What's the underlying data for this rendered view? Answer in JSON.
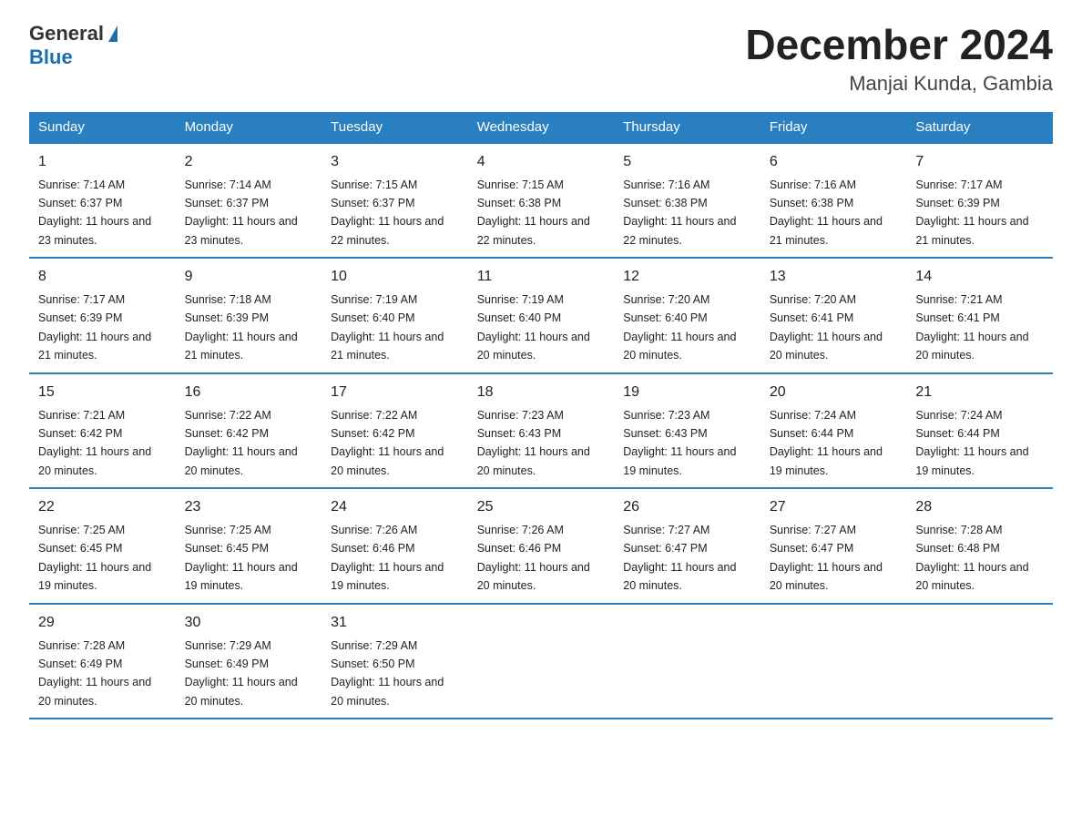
{
  "logo": {
    "general": "General",
    "blue": "Blue"
  },
  "title": "December 2024",
  "subtitle": "Manjai Kunda, Gambia",
  "days_of_week": [
    "Sunday",
    "Monday",
    "Tuesday",
    "Wednesday",
    "Thursday",
    "Friday",
    "Saturday"
  ],
  "weeks": [
    [
      {
        "day": "1",
        "sunrise": "7:14 AM",
        "sunset": "6:37 PM",
        "daylight": "11 hours and 23 minutes."
      },
      {
        "day": "2",
        "sunrise": "7:14 AM",
        "sunset": "6:37 PM",
        "daylight": "11 hours and 23 minutes."
      },
      {
        "day": "3",
        "sunrise": "7:15 AM",
        "sunset": "6:37 PM",
        "daylight": "11 hours and 22 minutes."
      },
      {
        "day": "4",
        "sunrise": "7:15 AM",
        "sunset": "6:38 PM",
        "daylight": "11 hours and 22 minutes."
      },
      {
        "day": "5",
        "sunrise": "7:16 AM",
        "sunset": "6:38 PM",
        "daylight": "11 hours and 22 minutes."
      },
      {
        "day": "6",
        "sunrise": "7:16 AM",
        "sunset": "6:38 PM",
        "daylight": "11 hours and 21 minutes."
      },
      {
        "day": "7",
        "sunrise": "7:17 AM",
        "sunset": "6:39 PM",
        "daylight": "11 hours and 21 minutes."
      }
    ],
    [
      {
        "day": "8",
        "sunrise": "7:17 AM",
        "sunset": "6:39 PM",
        "daylight": "11 hours and 21 minutes."
      },
      {
        "day": "9",
        "sunrise": "7:18 AM",
        "sunset": "6:39 PM",
        "daylight": "11 hours and 21 minutes."
      },
      {
        "day": "10",
        "sunrise": "7:19 AM",
        "sunset": "6:40 PM",
        "daylight": "11 hours and 21 minutes."
      },
      {
        "day": "11",
        "sunrise": "7:19 AM",
        "sunset": "6:40 PM",
        "daylight": "11 hours and 20 minutes."
      },
      {
        "day": "12",
        "sunrise": "7:20 AM",
        "sunset": "6:40 PM",
        "daylight": "11 hours and 20 minutes."
      },
      {
        "day": "13",
        "sunrise": "7:20 AM",
        "sunset": "6:41 PM",
        "daylight": "11 hours and 20 minutes."
      },
      {
        "day": "14",
        "sunrise": "7:21 AM",
        "sunset": "6:41 PM",
        "daylight": "11 hours and 20 minutes."
      }
    ],
    [
      {
        "day": "15",
        "sunrise": "7:21 AM",
        "sunset": "6:42 PM",
        "daylight": "11 hours and 20 minutes."
      },
      {
        "day": "16",
        "sunrise": "7:22 AM",
        "sunset": "6:42 PM",
        "daylight": "11 hours and 20 minutes."
      },
      {
        "day": "17",
        "sunrise": "7:22 AM",
        "sunset": "6:42 PM",
        "daylight": "11 hours and 20 minutes."
      },
      {
        "day": "18",
        "sunrise": "7:23 AM",
        "sunset": "6:43 PM",
        "daylight": "11 hours and 20 minutes."
      },
      {
        "day": "19",
        "sunrise": "7:23 AM",
        "sunset": "6:43 PM",
        "daylight": "11 hours and 19 minutes."
      },
      {
        "day": "20",
        "sunrise": "7:24 AM",
        "sunset": "6:44 PM",
        "daylight": "11 hours and 19 minutes."
      },
      {
        "day": "21",
        "sunrise": "7:24 AM",
        "sunset": "6:44 PM",
        "daylight": "11 hours and 19 minutes."
      }
    ],
    [
      {
        "day": "22",
        "sunrise": "7:25 AM",
        "sunset": "6:45 PM",
        "daylight": "11 hours and 19 minutes."
      },
      {
        "day": "23",
        "sunrise": "7:25 AM",
        "sunset": "6:45 PM",
        "daylight": "11 hours and 19 minutes."
      },
      {
        "day": "24",
        "sunrise": "7:26 AM",
        "sunset": "6:46 PM",
        "daylight": "11 hours and 19 minutes."
      },
      {
        "day": "25",
        "sunrise": "7:26 AM",
        "sunset": "6:46 PM",
        "daylight": "11 hours and 20 minutes."
      },
      {
        "day": "26",
        "sunrise": "7:27 AM",
        "sunset": "6:47 PM",
        "daylight": "11 hours and 20 minutes."
      },
      {
        "day": "27",
        "sunrise": "7:27 AM",
        "sunset": "6:47 PM",
        "daylight": "11 hours and 20 minutes."
      },
      {
        "day": "28",
        "sunrise": "7:28 AM",
        "sunset": "6:48 PM",
        "daylight": "11 hours and 20 minutes."
      }
    ],
    [
      {
        "day": "29",
        "sunrise": "7:28 AM",
        "sunset": "6:49 PM",
        "daylight": "11 hours and 20 minutes."
      },
      {
        "day": "30",
        "sunrise": "7:29 AM",
        "sunset": "6:49 PM",
        "daylight": "11 hours and 20 minutes."
      },
      {
        "day": "31",
        "sunrise": "7:29 AM",
        "sunset": "6:50 PM",
        "daylight": "11 hours and 20 minutes."
      },
      null,
      null,
      null,
      null
    ]
  ]
}
